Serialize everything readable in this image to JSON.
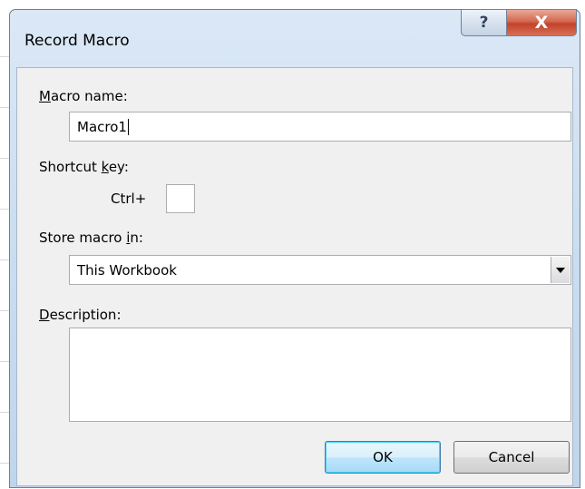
{
  "window": {
    "title": "Record Macro",
    "help_glyph": "?",
    "close_glyph": "X"
  },
  "form": {
    "macro_name": {
      "label_access_key": "M",
      "label_rest": "acro name:",
      "value": "Macro1"
    },
    "shortcut_key": {
      "label_prefix": "Shortcut ",
      "label_access_key": "k",
      "label_suffix": "ey:",
      "modifier_label": "Ctrl+",
      "value": ""
    },
    "store_macro_in": {
      "label_prefix": "Store macro ",
      "label_access_key": "i",
      "label_suffix": "n:",
      "selected_value": "This Workbook"
    },
    "description": {
      "label_access_key": "D",
      "label_rest": "escription:",
      "value": ""
    }
  },
  "buttons": {
    "ok_label": "OK",
    "cancel_label": "Cancel"
  },
  "colors": {
    "title_bar": "#cddff1",
    "client_area": "#f0f0f0",
    "close_button": "#c2432a",
    "default_button_border": "#3c7fb1"
  },
  "icons": {
    "help": "question-mark-icon",
    "close": "close-x-icon",
    "dropdown": "chevron-down-icon"
  }
}
